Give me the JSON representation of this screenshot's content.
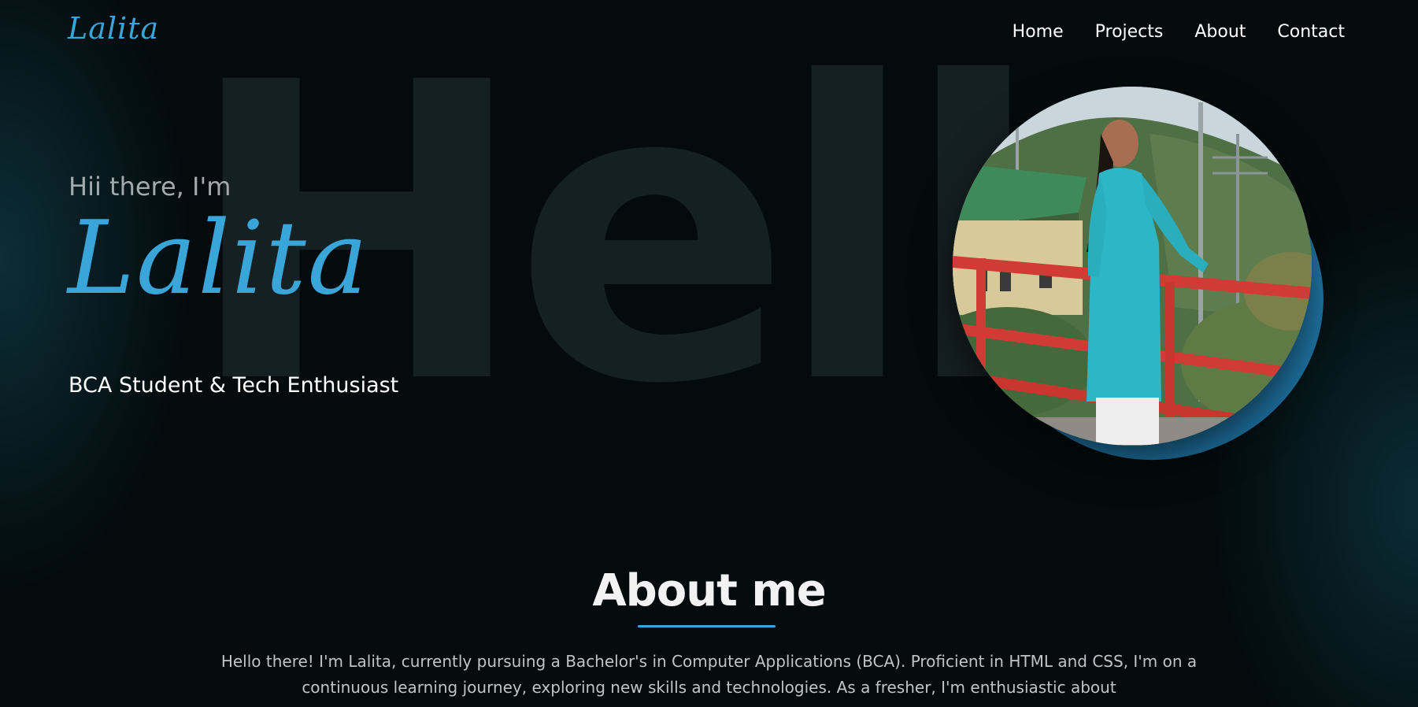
{
  "brand": {
    "logo": "Lalita"
  },
  "nav": {
    "items": [
      {
        "label": "Home"
      },
      {
        "label": "Projects"
      },
      {
        "label": "About"
      },
      {
        "label": "Contact"
      }
    ]
  },
  "hero": {
    "background_word": "Hello",
    "greeting": "Hii there, I'm",
    "name": "Lalita",
    "subtitle": "BCA Student & Tech Enthusiast"
  },
  "about": {
    "title": "About me",
    "text": "Hello there! I'm Lalita, currently pursuing a Bachelor's in Computer Applications (BCA). Proficient in HTML and CSS, I'm on a continuous learning journey, exploring new skills and technologies. As a fresher, I'm enthusiastic about"
  },
  "colors": {
    "background": "#030b0d",
    "accent": "#3aa5d8",
    "background_word": "#152022",
    "text": "#ffffff",
    "muted_text": "#a2aaad"
  }
}
